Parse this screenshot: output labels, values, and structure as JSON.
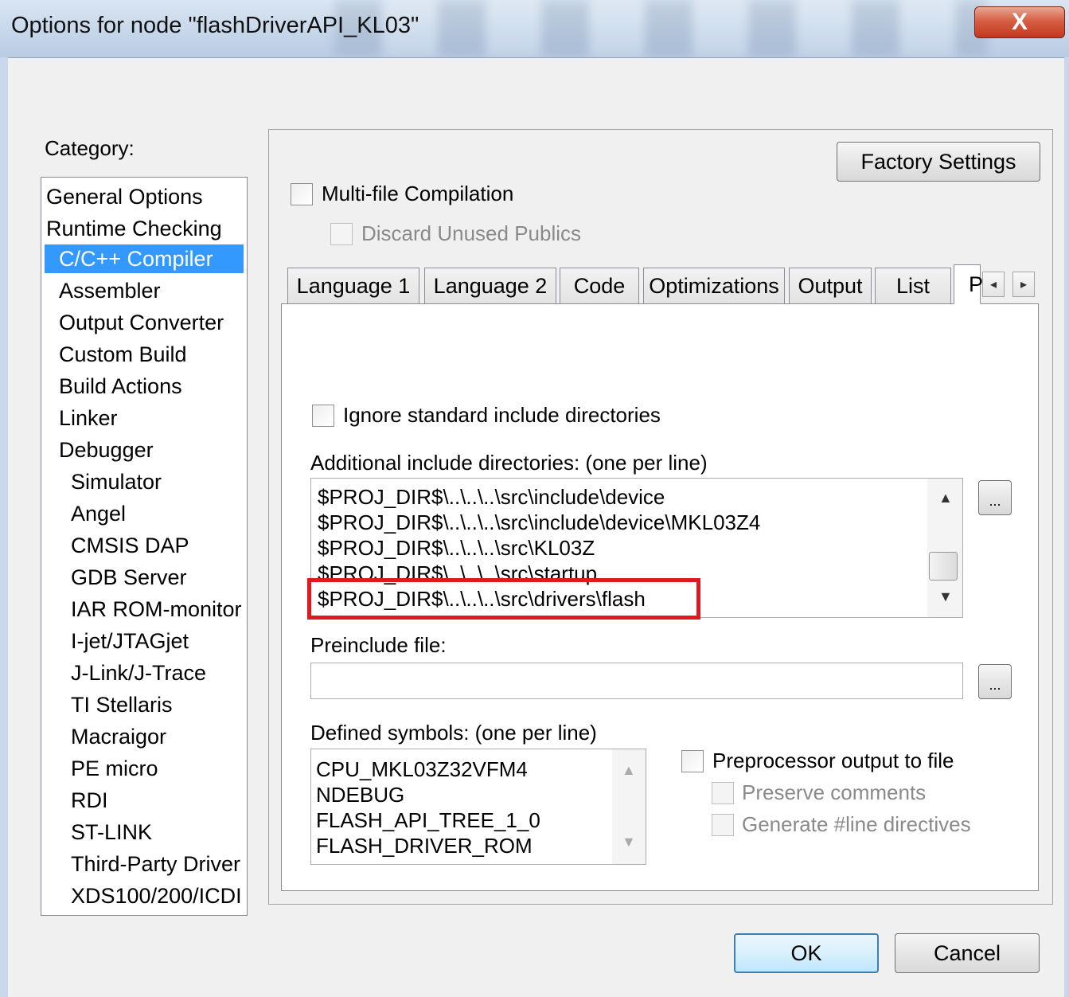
{
  "window": {
    "title": "Options for node \"flashDriverAPI_KL03\"",
    "close_glyph": "X"
  },
  "category": {
    "label": "Category:",
    "items": [
      "General Options",
      "Runtime Checking",
      "C/C++ Compiler",
      "Assembler",
      "Output Converter",
      "Custom Build",
      "Build Actions",
      "Linker",
      "Debugger",
      "Simulator",
      "Angel",
      "CMSIS DAP",
      "GDB Server",
      "IAR ROM-monitor",
      "I-jet/JTAGjet",
      "J-Link/J-Trace",
      "TI Stellaris",
      "Macraigor",
      "PE micro",
      "RDI",
      "ST-LINK",
      "Third-Party Driver",
      "XDS100/200/ICDI"
    ],
    "selected": "C/C++ Compiler"
  },
  "top": {
    "factory_settings": "Factory Settings",
    "multi_file": "Multi-file Compilation",
    "discard_unused": "Discard Unused Publics"
  },
  "tabs": {
    "items": [
      "Language 1",
      "Language 2",
      "Code",
      "Optimizations",
      "Output",
      "List",
      "P"
    ],
    "active": "P",
    "scroll_left": "◂",
    "scroll_right": "▸"
  },
  "preprocessor": {
    "ignore_std": "Ignore standard include directories",
    "include_label": "Additional include directories: (one per line)",
    "include_lines": [
      "$PROJ_DIR$\\..\\..\\..\\src\\include\\device",
      "$PROJ_DIR$\\..\\..\\..\\src\\include\\device\\MKL03Z4",
      "$PROJ_DIR$\\..\\..\\..\\src\\KL03Z",
      "$PROJ_DIR$\\..\\..\\..\\src\\startup",
      "$PROJ_DIR$\\..\\..\\..\\src\\drivers\\flash"
    ],
    "browse": "...",
    "preinclude_label": "Preinclude file:",
    "preinclude_value": "",
    "defined_label": "Defined symbols: (one per line)",
    "defined_lines": [
      "CPU_MKL03Z32VFM4",
      "NDEBUG",
      "FLASH_API_TREE_1_0",
      "FLASH_DRIVER_ROM"
    ],
    "pp_output": "Preprocessor output to file",
    "preserve_comments": "Preserve comments",
    "generate_line": "Generate #line directives"
  },
  "buttons": {
    "ok": "OK",
    "cancel": "Cancel"
  },
  "colors": {
    "selection": "#3399ff",
    "highlight": "#e0191f"
  }
}
